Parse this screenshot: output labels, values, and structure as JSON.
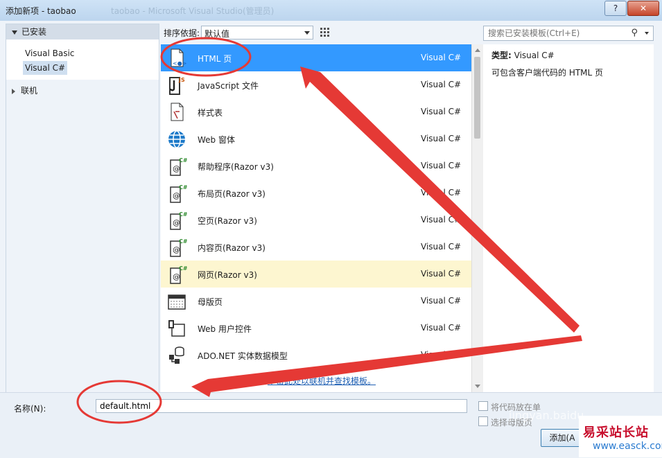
{
  "window": {
    "title": "添加新项 - taobao",
    "ghost_title": "taobao - Microsoft Visual Studio(管理员)",
    "help_label": "?",
    "close_label": "✕"
  },
  "left_panel": {
    "installed_header": "已安装",
    "items": [
      "Visual Basic",
      "Visual C#"
    ],
    "online_label": "联机"
  },
  "toolbar": {
    "sort_label": "排序依据:",
    "sort_value": "默认值",
    "search_placeholder": "搜索已安装模板(Ctrl+E)"
  },
  "templates": [
    {
      "name": "HTML 页",
      "lang": "Visual C#",
      "icon": "html-page-icon"
    },
    {
      "name": "JavaScript 文件",
      "lang": "Visual C#",
      "icon": "javascript-file-icon"
    },
    {
      "name": "样式表",
      "lang": "Visual C#",
      "icon": "stylesheet-icon"
    },
    {
      "name": "Web 窗体",
      "lang": "Visual C#",
      "icon": "web-form-globe-icon"
    },
    {
      "name": "帮助程序(Razor v3)",
      "lang": "Visual C#",
      "icon": "razor-file-icon"
    },
    {
      "name": "布局页(Razor v3)",
      "lang": "Visual C#",
      "icon": "razor-file-icon"
    },
    {
      "name": "空页(Razor v3)",
      "lang": "Visual C#",
      "icon": "razor-file-icon"
    },
    {
      "name": "内容页(Razor v3)",
      "lang": "Visual C#",
      "icon": "razor-file-icon"
    },
    {
      "name": "网页(Razor v3)",
      "lang": "Visual C#",
      "icon": "razor-file-icon"
    },
    {
      "name": "母版页",
      "lang": "Visual C#",
      "icon": "master-page-icon"
    },
    {
      "name": "Web 用户控件",
      "lang": "Visual C#",
      "icon": "user-control-icon"
    },
    {
      "name": "ADO.NET 实体数据模型",
      "lang": "Visual C#",
      "icon": "entity-data-model-icon"
    }
  ],
  "online_link": "单击此处以联机并查找模板。",
  "info": {
    "type_label": "类型:",
    "type_value": "Visual C#",
    "description": "可包含客户端代码的 HTML 页"
  },
  "bottom": {
    "name_label": "名称(N):",
    "name_value": "default.html",
    "check1": "将代码放在单",
    "check2": "选择母版页",
    "add_button": "添加(A"
  },
  "watermark": {
    "site_cn": "易采站长站",
    "site_en": "www.easck.com",
    "jingyan": "jingyan.baidu"
  },
  "colors": {
    "selected_row": "#3399ff",
    "highlight_row": "#fdf6d0",
    "annotation": "#e53935"
  }
}
